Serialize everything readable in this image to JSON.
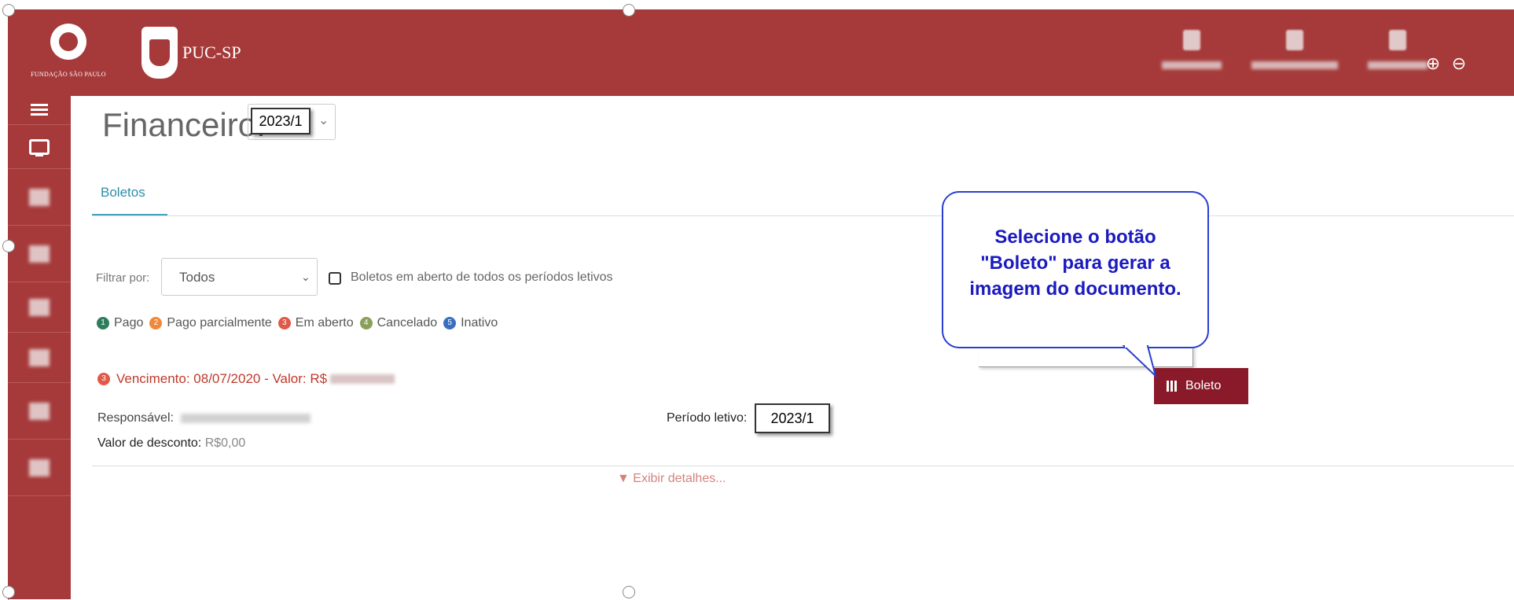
{
  "header": {
    "fsp_logo_text": "FUNDAÇÃO SÃO PAULO",
    "puc_logo_text": "PUC-SP",
    "zoom_in_symbol": "⊕",
    "zoom_out_symbol": "⊖"
  },
  "page": {
    "title": "Financeiro:",
    "year_selected": "2023/1",
    "tab_boletos": "Boletos"
  },
  "filter": {
    "label": "Filtrar por:",
    "selected": "Todos",
    "checkbox_label": "Boletos em aberto de todos os períodos letivos"
  },
  "legend": [
    {
      "count": "1",
      "label": "Pago",
      "color": "#2e7d5b"
    },
    {
      "count": "2",
      "label": "Pago parcialmente",
      "color": "#f0883a"
    },
    {
      "count": "3",
      "label": "Em aberto",
      "color": "#e05a4a"
    },
    {
      "count": "4",
      "label": "Cancelado",
      "color": "#8aa05a"
    },
    {
      "count": "5",
      "label": "Inativo",
      "color": "#3a6fc0"
    }
  ],
  "boleto": {
    "count": "3",
    "vencimento": "Vencimento: 08/07/2020 - Valor: R$",
    "responsavel_label": "Responsável:",
    "desconto_label": "Valor de desconto:",
    "desconto_value": "R$0,00",
    "periodo_label": "Período letivo:",
    "periodo_value": "2023/1",
    "exibir": "▼ Exibir detalhes...",
    "button_label": "Boleto"
  },
  "callout": {
    "text_line1": "Selecione o botão",
    "text_line2": "\"Boleto\" para gerar a",
    "text_line3": "imagem do documento."
  }
}
